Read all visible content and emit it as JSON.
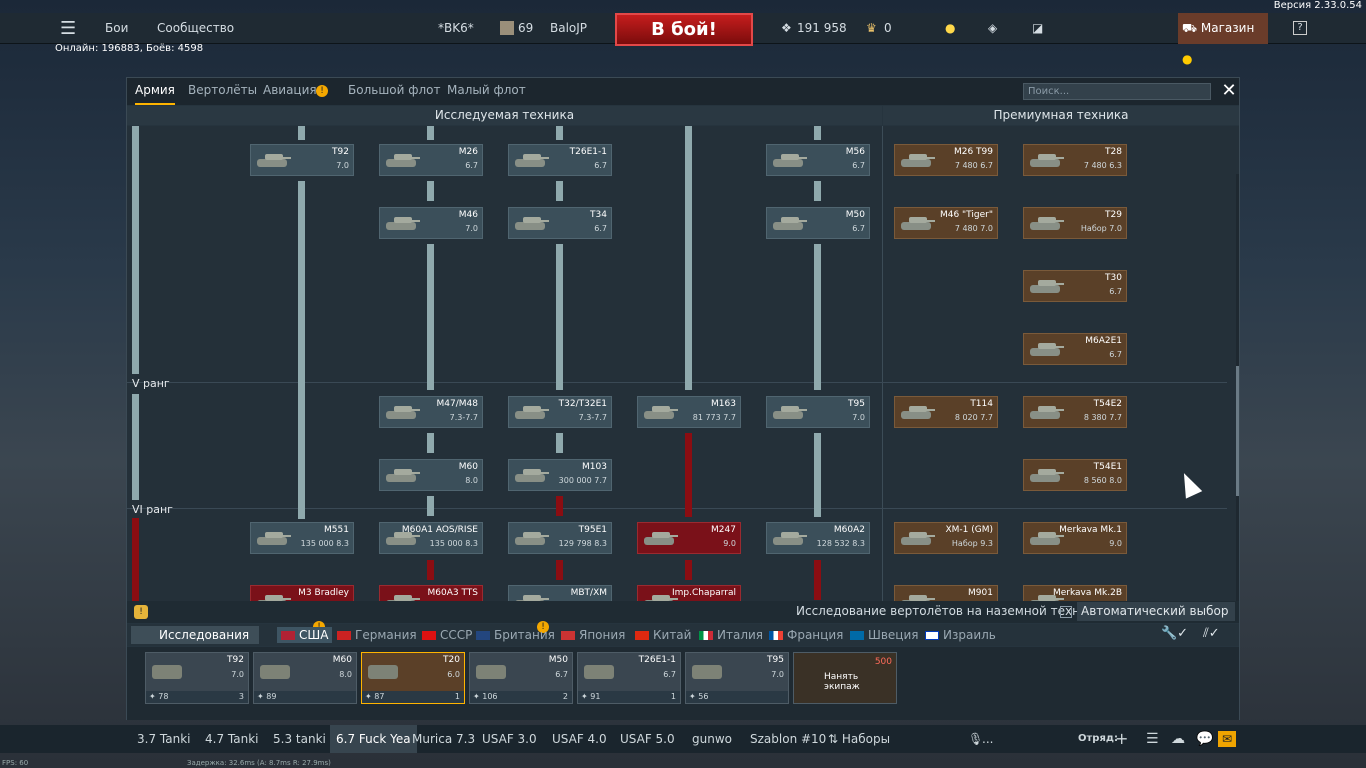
{
  "app": {
    "version": "Версия 2.33.0.54"
  },
  "topbar": {
    "battles": "Бои",
    "community": "Сообщество",
    "preset": "*BK6*",
    "level": "69",
    "nickname": "BaloJP",
    "battle_button": "В бой!",
    "silver": "191 958",
    "gold": "0",
    "shop": "Магазин",
    "help": "?"
  },
  "status": {
    "online": "Онлайн: 196883, Боёв: 4598"
  },
  "tabs": [
    {
      "label": "Армия"
    },
    {
      "label": "Вертолёты"
    },
    {
      "label": "Авиация"
    },
    {
      "label": "Большой флот"
    },
    {
      "label": "Малый флот"
    }
  ],
  "search": {
    "placeholder": "Поиск..."
  },
  "sections": {
    "researched": "Исследуемая техника",
    "premium": "Премиумная техника"
  },
  "ranks": {
    "r5": "V ранг",
    "r6": "VI ранг"
  },
  "tree": [
    {
      "name": "T92",
      "br": "7.0",
      "row": 0,
      "col": 1
    },
    {
      "name": "M26",
      "br": "6.7",
      "row": 0,
      "col": 2
    },
    {
      "name": "T26E1-1",
      "br": "6.7",
      "row": 0,
      "col": 3
    },
    {
      "name": "M56",
      "br": "6.7",
      "row": 0,
      "col": 5
    },
    {
      "name": "M46",
      "br": "7.0",
      "row": 1,
      "col": 2
    },
    {
      "name": "T34",
      "br": "6.7",
      "row": 1,
      "col": 3
    },
    {
      "name": "M50",
      "br": "6.7",
      "row": 1,
      "col": 5
    },
    {
      "name": "M47/M48",
      "br": "7.3-7.7",
      "row": 4,
      "col": 2
    },
    {
      "name": "T32/T32E1",
      "br": "7.3-7.7",
      "row": 4,
      "col": 3
    },
    {
      "name": "M163",
      "br": "81 773 7.7",
      "row": 4,
      "col": 4
    },
    {
      "name": "T95",
      "br": "7.0",
      "row": 4,
      "col": 5
    },
    {
      "name": "M60",
      "br": "8.0",
      "row": 5,
      "col": 2
    },
    {
      "name": "M103",
      "br": "300 000 7.7",
      "row": 5,
      "col": 3
    },
    {
      "name": "M551",
      "br": "135 000 8.3",
      "row": 6,
      "col": 1
    },
    {
      "name": "M60A1 AOS/RISE",
      "br": "135 000 8.3",
      "row": 6,
      "col": 2
    },
    {
      "name": "T95E1",
      "br": "129 798 8.3",
      "row": 6,
      "col": 3
    },
    {
      "name": "M247",
      "br": "9.0",
      "row": 6,
      "col": 4,
      "red": true
    },
    {
      "name": "M60A2",
      "br": "128 532 8.3",
      "row": 6,
      "col": 5
    },
    {
      "name": "M3 Bradley",
      "br": "",
      "row": 7,
      "col": 1,
      "red": true
    },
    {
      "name": "M60A3 TTS",
      "br": "",
      "row": 7,
      "col": 2,
      "red": true
    },
    {
      "name": "MBT/XM",
      "br": "",
      "row": 7,
      "col": 3
    },
    {
      "name": "Imp.Chaparral",
      "br": "",
      "row": 7,
      "col": 4,
      "red": true
    }
  ],
  "premium": [
    {
      "name": "M26 T99",
      "br": "7 480 6.7",
      "row": 0,
      "col": 0
    },
    {
      "name": "T28",
      "br": "7 480 6.3",
      "row": 0,
      "col": 1
    },
    {
      "name": "M46 \"Tiger\"",
      "br": "7 480 7.0",
      "row": 1,
      "col": 0
    },
    {
      "name": "T29",
      "br": "Набор 7.0",
      "row": 1,
      "col": 1
    },
    {
      "name": "T30",
      "br": "6.7",
      "row": 2,
      "col": 1
    },
    {
      "name": "M6A2E1",
      "br": "6.7",
      "row": 3,
      "col": 1
    },
    {
      "name": "T114",
      "br": "8 020 7.7",
      "row": 4,
      "col": 0
    },
    {
      "name": "T54E2",
      "br": "8 380 7.7",
      "row": 4,
      "col": 1
    },
    {
      "name": "T54E1",
      "br": "8 560 8.0",
      "row": 5,
      "col": 1
    },
    {
      "name": "XM-1 (GM)",
      "br": "Набор 9.3",
      "row": 6,
      "col": 0
    },
    {
      "name": "Merkava Mk.1",
      "br": "9.0",
      "row": 6,
      "col": 1
    },
    {
      "name": "M901",
      "br": "",
      "row": 7,
      "col": 0
    },
    {
      "name": "Merkava Mk.2B",
      "br": "",
      "row": 7,
      "col": 1
    }
  ],
  "heli_research": {
    "label": "Исследование вертолётов на наземной технике",
    "select": "Автоматический выбор"
  },
  "research_button": "Исследования",
  "nations": [
    "США",
    "Германия",
    "СССР",
    "Британия",
    "Япония",
    "Китай",
    "Италия",
    "Франция",
    "Швеция",
    "Израиль"
  ],
  "crew": [
    {
      "name": "T92",
      "br": "7.0",
      "footer": "78",
      "extra": "3"
    },
    {
      "name": "M60",
      "br": "8.0",
      "footer": "89",
      "extra": ""
    },
    {
      "name": "T20",
      "br": "6.0",
      "footer": "87",
      "extra": "1"
    },
    {
      "name": "M50",
      "br": "6.7",
      "footer": "106",
      "extra": "2"
    },
    {
      "name": "T26E1-1",
      "br": "6.7",
      "footer": "91",
      "extra": "1"
    },
    {
      "name": "T95",
      "br": "7.0",
      "footer": "56",
      "extra": ""
    }
  ],
  "hire": {
    "cost": "500",
    "label": "Нанять экипаж"
  },
  "presets": [
    "3.7 Tanki",
    "4.7 Tanki",
    "5.3 tanki",
    "6.7 Fuck Yea",
    "Murica 7.3",
    "USAF  3.0",
    "USAF 4.0",
    "USAF 5.0",
    "gunwo",
    "Szablon #10",
    "Наборы"
  ],
  "squad": "Отряд:",
  "mic": "...",
  "debug": {
    "fps": "FPS: 60",
    "ping": "Задержка: 32.6ms (A:  8.7ms R: 27.9ms)"
  }
}
